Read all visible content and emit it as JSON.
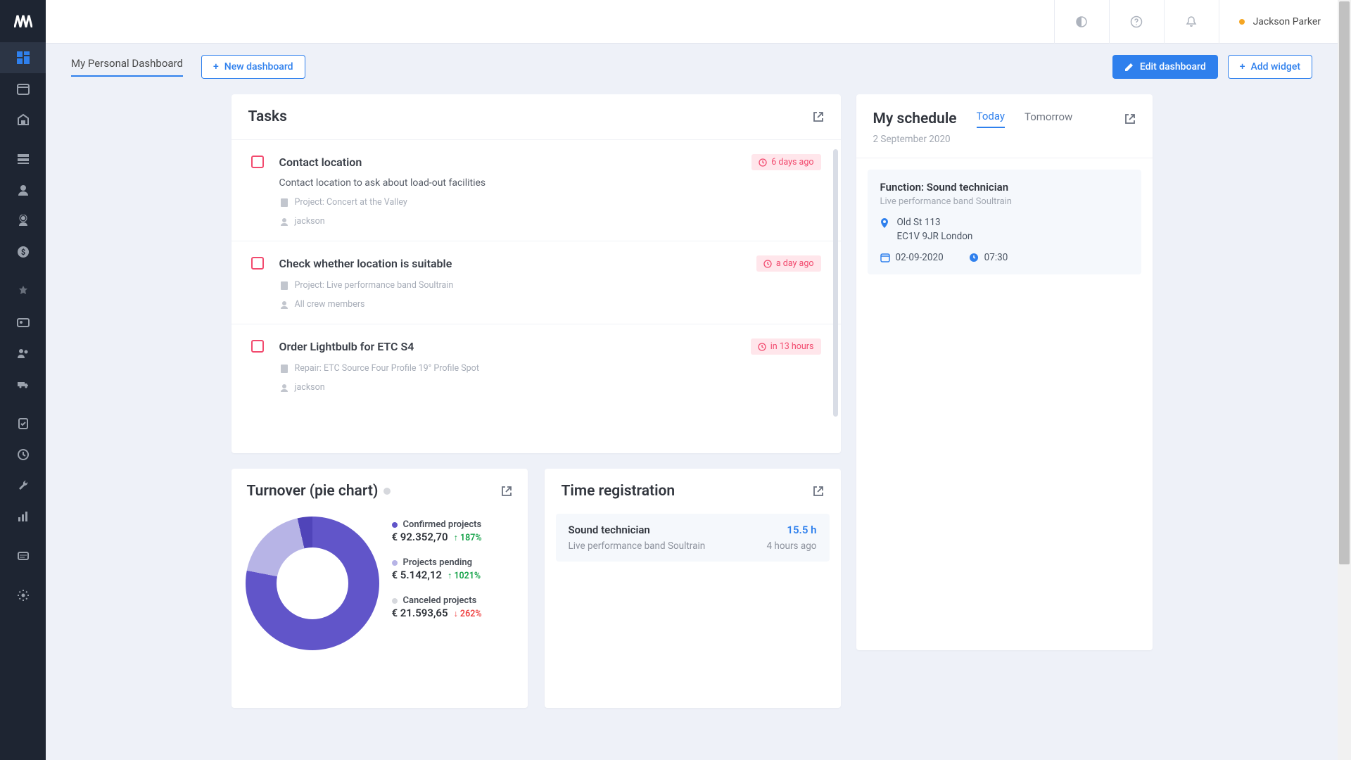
{
  "user": {
    "name": "Jackson Parker"
  },
  "toolbar": {
    "dash_title": "My Personal Dashboard",
    "new_dashboard": "New dashboard",
    "edit_dashboard": "Edit dashboard",
    "add_widget": "Add widget"
  },
  "tasks": {
    "title": "Tasks",
    "items": [
      {
        "title": "Contact location",
        "desc": "Contact location to ask about load-out facilities",
        "project": "Project: Concert at the Valley",
        "assignee": "jackson",
        "due": "6 days ago"
      },
      {
        "title": "Check whether location is suitable",
        "desc": "",
        "project": "Project: Live performance band Soultrain",
        "assignee": "All crew members",
        "due": "a day ago"
      },
      {
        "title": "Order Lightbulb for ETC S4",
        "desc": "",
        "project": "Repair: ETC Source Four Profile 19° Profile Spot",
        "assignee": "jackson",
        "due": "in 13 hours"
      }
    ]
  },
  "schedule": {
    "title": "My schedule",
    "tab_today": "Today",
    "tab_tomorrow": "Tomorrow",
    "date": "2 September 2020",
    "item": {
      "fn": "Function: Sound technician",
      "sub": "Live performance band Soultrain",
      "addr1": "Old St 113",
      "addr2": "EC1V 9JR London",
      "date_val": "02-09-2020",
      "time_val": "07:30"
    }
  },
  "turnover": {
    "title": "Turnover (pie chart)",
    "legend": [
      {
        "label": "Confirmed projects",
        "value": "€ 92.352,70",
        "pct": "↑ 187%",
        "neg": false,
        "color": "#6155c9"
      },
      {
        "label": "Projects pending",
        "value": "€ 5.142,12",
        "pct": "↑ 1021%",
        "neg": false,
        "color": "#b7b4e6"
      },
      {
        "label": "Canceled projects",
        "value": "€ 21.593,65",
        "pct": "↓ 262%",
        "neg": true,
        "color": "#d6d8dd"
      }
    ]
  },
  "time": {
    "title": "Time registration",
    "item": {
      "name": "Sound technician",
      "hours": "15.5 h",
      "sub": "Live performance band Soultrain",
      "ago": "4 hours ago"
    }
  },
  "chart_data": {
    "type": "pie",
    "series": [
      {
        "name": "Confirmed projects",
        "value": 92352.7,
        "pct_change": 187,
        "direction": "up",
        "color": "#6155c9"
      },
      {
        "name": "Projects pending",
        "value": 5142.12,
        "pct_change": 1021,
        "direction": "up",
        "color": "#b7b4e6"
      },
      {
        "name": "Canceled projects",
        "value": 21593.65,
        "pct_change": 262,
        "direction": "down",
        "color": "#d6d8dd"
      }
    ],
    "title": "Turnover (pie chart)",
    "currency": "EUR"
  }
}
